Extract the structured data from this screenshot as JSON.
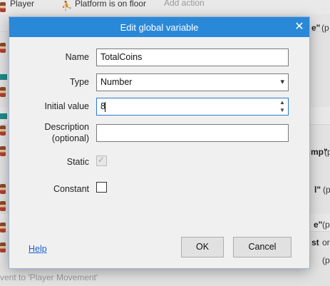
{
  "background": {
    "top_object": "Player",
    "top_condition": "Platform is on floor",
    "top_action_placeholder": "Add action",
    "frag_1": "e\"",
    "frag_1b": "(p",
    "frag_2": "mp\"",
    "frag_2b": "(p",
    "frag_3": "l\"",
    "frag_3b": "(p",
    "frag_4": "e\"",
    "frag_4b": "(p",
    "frag_5": "st",
    "frag_5b": "or",
    "frag_6": "(p",
    "bottom_text": "vent to 'Player Movement'"
  },
  "dialog": {
    "title": "Edit global variable",
    "close_icon": "close-icon",
    "fields": {
      "name_label": "Name",
      "name_value": "TotalCoins",
      "type_label": "Type",
      "type_value": "Number",
      "initial_label": "Initial value",
      "initial_value": "8",
      "description_label_line1": "Description",
      "description_label_line2": "(optional)",
      "description_value": "",
      "static_label": "Static",
      "static_checked": true,
      "static_disabled": true,
      "constant_label": "Constant",
      "constant_checked": false
    },
    "help_label": "Help",
    "ok_label": "OK",
    "cancel_label": "Cancel"
  }
}
